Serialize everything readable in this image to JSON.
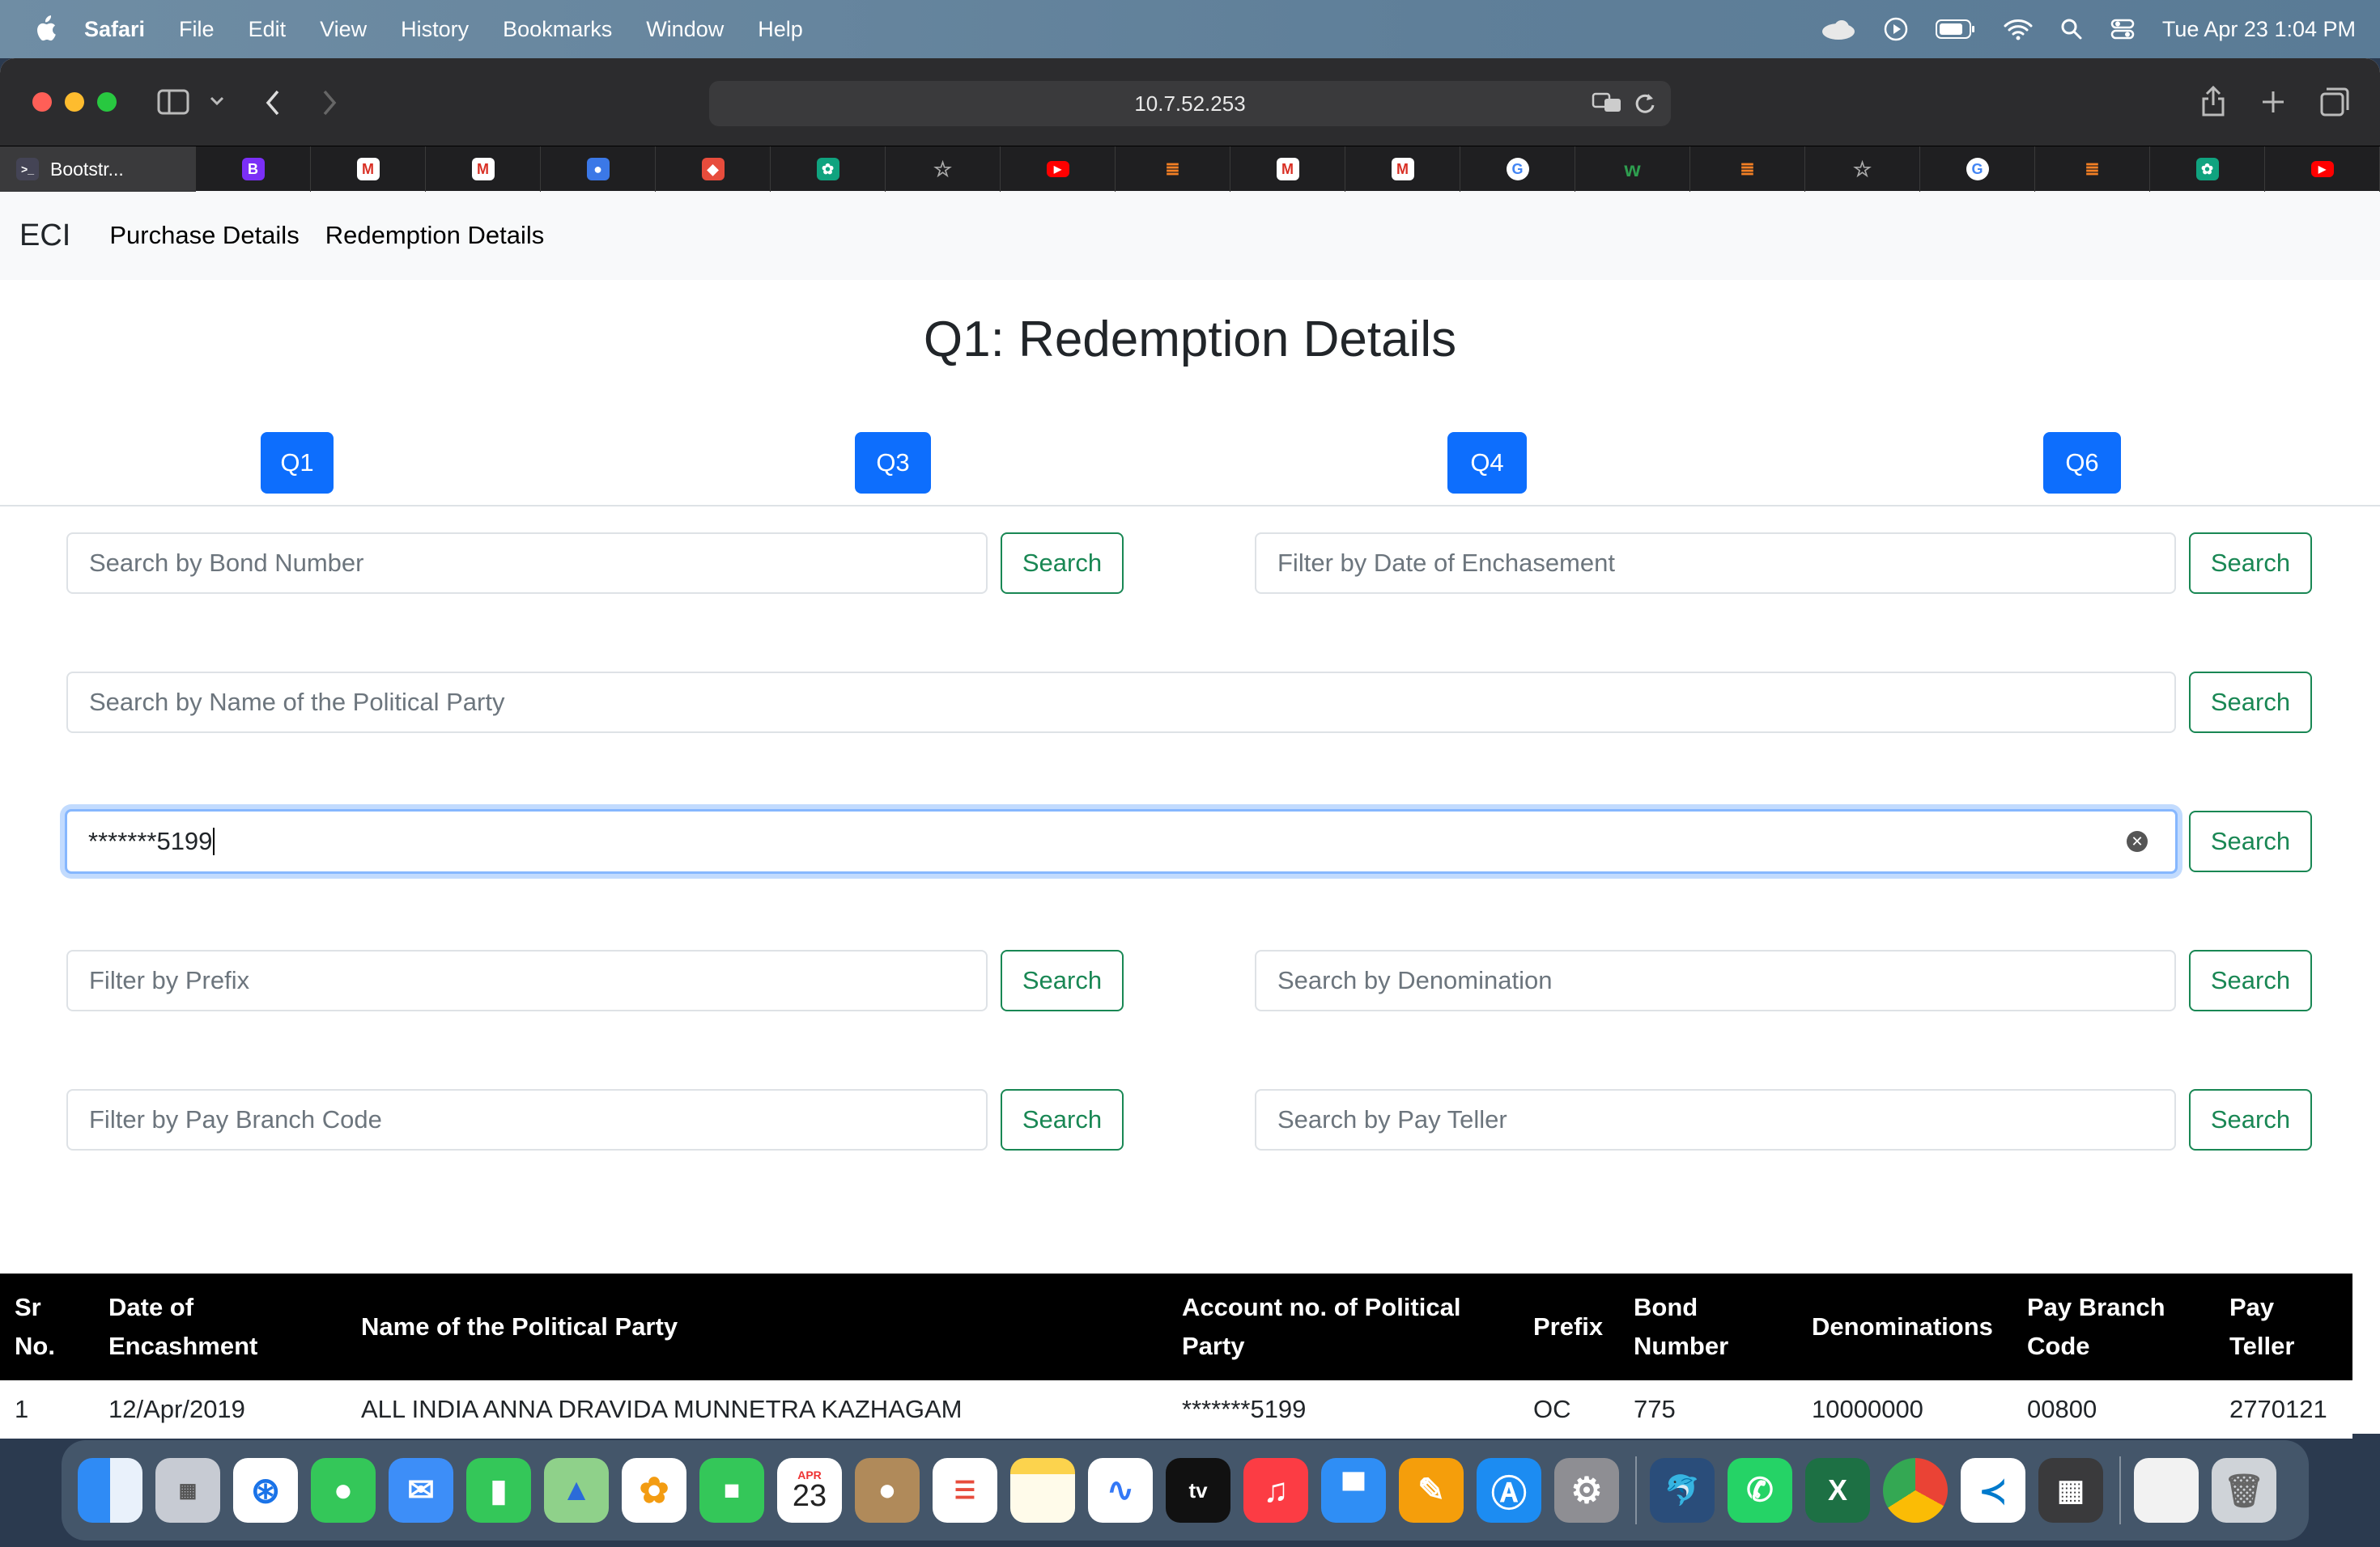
{
  "menubar": {
    "app": "Safari",
    "items": [
      "File",
      "Edit",
      "View",
      "History",
      "Bookmarks",
      "Window",
      "Help"
    ],
    "clock": "Tue Apr 23  1:04 PM",
    "status_icons": [
      "icloud-icon",
      "play-icon",
      "battery-icon",
      "wifi-icon",
      "search-icon",
      "control-center-icon"
    ]
  },
  "browser": {
    "url": "10.7.52.253",
    "active_tab_title": "Bootstr...",
    "tab_icons": [
      "bootstrap-icon",
      "gmail-icon",
      "gmail-icon",
      "contacts-icon",
      "generic-icon",
      "openai-icon",
      "star-icon",
      "youtube-icon",
      "stackoverflow-icon",
      "gmail-icon",
      "gmail-icon",
      "google-icon",
      "w-icon",
      "stackoverflow-icon",
      "star-icon",
      "google-icon",
      "stackoverflow-icon",
      "openai-icon",
      "youtube-icon"
    ]
  },
  "nav": {
    "brand": "ECI",
    "links": [
      "Purchase Details",
      "Redemption Details"
    ]
  },
  "page": {
    "title": "Q1: Redemption Details",
    "q_buttons": [
      "Q1",
      "Q3",
      "Q4",
      "Q6"
    ]
  },
  "filters": {
    "bond_number": "Search by Bond Number",
    "date_enc": "Filter by Date of Enchasement",
    "party_name": "Search by Name of the Political Party",
    "account_value": "*******5199",
    "prefix": "Filter by Prefix",
    "denomination": "Search by Denomination",
    "branch_code": "Filter by Pay Branch Code",
    "pay_teller": "Search by Pay Teller",
    "search_label": "Search"
  },
  "table": {
    "headers": {
      "sr": "Sr No.",
      "date": "Date of Encashment",
      "party": "Name of the Political Party",
      "account": "Account no. of Political Party",
      "prefix": "Prefix",
      "bond": "Bond Number",
      "denom": "Denominations",
      "branch": "Pay Branch Code",
      "teller": "Pay Teller"
    },
    "rows": [
      {
        "sr": "1",
        "date": "12/Apr/2019",
        "party": "ALL INDIA ANNA DRAVIDA MUNNETRA KAZHAGAM",
        "account": "*******5199",
        "prefix": "OC",
        "bond": "775",
        "denom": "10000000",
        "branch": "00800",
        "teller": "2770121"
      }
    ]
  },
  "dock": {
    "calendar_month": "APR",
    "calendar_day": "23",
    "tv_label": "tv"
  }
}
